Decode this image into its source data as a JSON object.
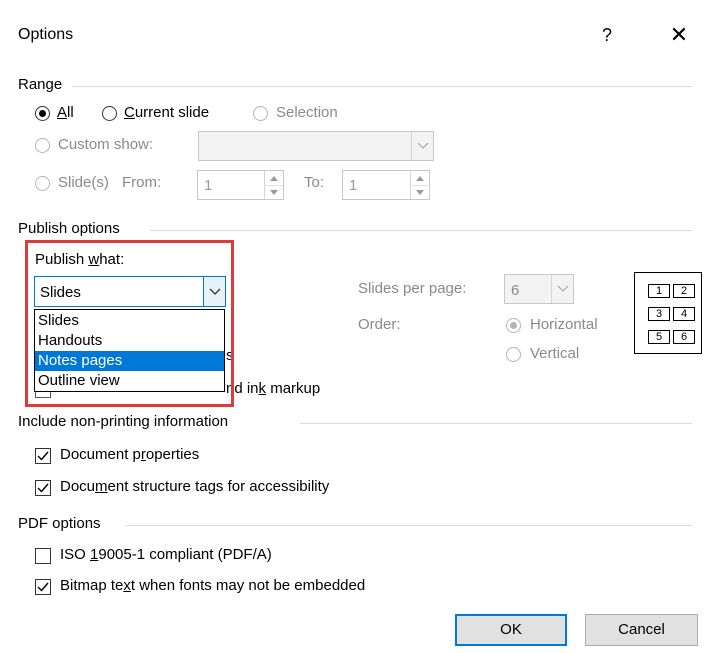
{
  "dialog": {
    "title": "Options",
    "help_symbol": "?",
    "close_symbol": "✕"
  },
  "range": {
    "label": "Range",
    "all": "All",
    "current_slide": "Current slide",
    "selection": "Selection",
    "custom_show": "Custom show:",
    "slides": "Slide(s)",
    "from_label": "From:",
    "from_value": "1",
    "to_label": "To:",
    "to_value": "1",
    "selected": "All"
  },
  "publish": {
    "label": "Publish options",
    "publish_what_label": "Publish what:",
    "publish_what_value": "Slides",
    "dropdown_options": [
      "Slides",
      "Handouts",
      "Notes pages",
      "Outline view"
    ],
    "highlighted_option": "Notes pages",
    "hidden_partial_1": "s",
    "hidden_partial_2": "nd ink markup",
    "slides_per_page_label": "Slides per page:",
    "slides_per_page_value": "6",
    "order_label": "Order:",
    "horizontal": "Horizontal",
    "vertical": "Vertical",
    "layout_numbers": [
      "1",
      "2",
      "3",
      "4",
      "5",
      "6"
    ]
  },
  "nonprinting": {
    "label": "Include non-printing information",
    "document_properties": "Document properties",
    "document_properties_checked": true,
    "structure_tags": "Document structure tags for accessibility",
    "structure_tags_checked": true
  },
  "pdf": {
    "label": "PDF options",
    "iso": "ISO 19005-1 compliant (PDF/A)",
    "iso_checked": false,
    "bitmap": "Bitmap text when fonts may not be embedded",
    "bitmap_checked": true
  },
  "buttons": {
    "ok": "OK",
    "cancel": "Cancel"
  },
  "colors": {
    "accent": "#0078d7",
    "highlight_border": "#e03b3b"
  }
}
